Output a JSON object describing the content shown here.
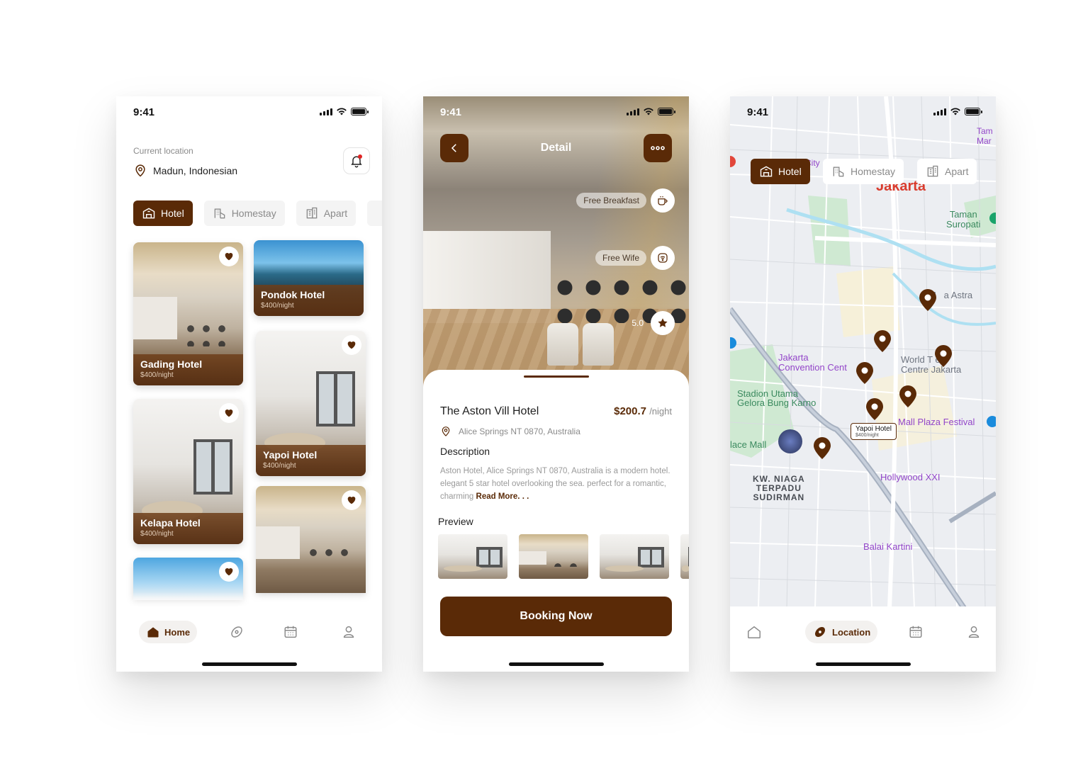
{
  "status": {
    "time": "9:41"
  },
  "home": {
    "location_label": "Current location",
    "location_value": "Madun, Indonesian",
    "icons": {
      "location": "location-pin-icon",
      "bell": "bell-icon",
      "heart": "heart-icon"
    },
    "chips": [
      {
        "label": "Hotel",
        "icon": "hotel-icon",
        "active": true
      },
      {
        "label": "Homestay",
        "icon": "homestay-icon",
        "active": false
      },
      {
        "label": "Apart",
        "icon": "apartment-icon",
        "active": false
      }
    ],
    "cards": [
      {
        "name": "Gading Hotel",
        "price": "$400/night"
      },
      {
        "name": "Pondok Hotel",
        "price": "$400/night"
      },
      {
        "name": "Kelapa Hotel",
        "price": "$400/night"
      },
      {
        "name": "Yapoi Hotel",
        "price": "$400/night"
      }
    ],
    "tabs": [
      {
        "label": "Home",
        "icon": "home-icon",
        "active": true
      },
      {
        "label": "",
        "icon": "explore-icon",
        "active": false
      },
      {
        "label": "",
        "icon": "calendar-icon",
        "active": false
      },
      {
        "label": "",
        "icon": "profile-icon",
        "active": false
      }
    ]
  },
  "detail": {
    "title": "Detail",
    "icons": {
      "back": "back-chevron-icon",
      "more": "more-dots-icon",
      "breakfast": "coffee-cup-icon",
      "wifi": "wifi-icon",
      "rating": "star-icon",
      "address": "location-pin-icon"
    },
    "amenities": [
      {
        "label": "Free Breakfast"
      },
      {
        "label": "Free Wife"
      }
    ],
    "rating": "5.0",
    "hotel_name": "The Aston Vill Hotel",
    "price": "$200.7",
    "price_unit": "/night",
    "address": "Alice Springs NT 0870, Australia",
    "description_title": "Description",
    "description": "Aston Hotel, Alice Springs NT 0870, Australia is a modern hotel. elegant 5 star hotel overlooking the sea. perfect for a romantic, charming",
    "read_more": "Read More. . .",
    "preview_title": "Preview",
    "book_label": "Booking Now"
  },
  "map": {
    "chips": [
      {
        "label": "Hotel",
        "active": true
      },
      {
        "label": "Homestay",
        "active": false
      },
      {
        "label": "Apart",
        "active": false
      }
    ],
    "labels": {
      "city": "Jakarta",
      "taman": "Taman\nSuropati",
      "tam_mar": "Tam\nMar",
      "menara": "M   a Astra",
      "convention": "Jakarta\nConvention Cent",
      "world": "World T  e\nCentre Jakarta",
      "stadion": "Stadion Utama\nGelora Bung Karno",
      "mall_plaza": "Mall Plaza Festival",
      "ace_mall": "lace Mall",
      "niaga": "KW. NIAGA\nTERPADU\nSUDIRMAN",
      "hollywood": "Hollywood XXI",
      "balai": "Balai Kartini",
      "city_partial": "City"
    },
    "callout": {
      "name": "Yapoi Hotel",
      "price": "$400/night"
    },
    "icons": {
      "pin": "map-pin-icon"
    },
    "tabs": [
      {
        "label": "",
        "icon": "home-icon",
        "active": false
      },
      {
        "label": "Location",
        "icon": "explore-icon",
        "active": true
      },
      {
        "label": "",
        "icon": "calendar-icon",
        "active": false
      },
      {
        "label": "",
        "icon": "profile-icon",
        "active": false
      }
    ]
  },
  "colors": {
    "brand": "#5A2A07",
    "muted": "#8A8A8A",
    "chip_bg": "#F4F4F4"
  }
}
